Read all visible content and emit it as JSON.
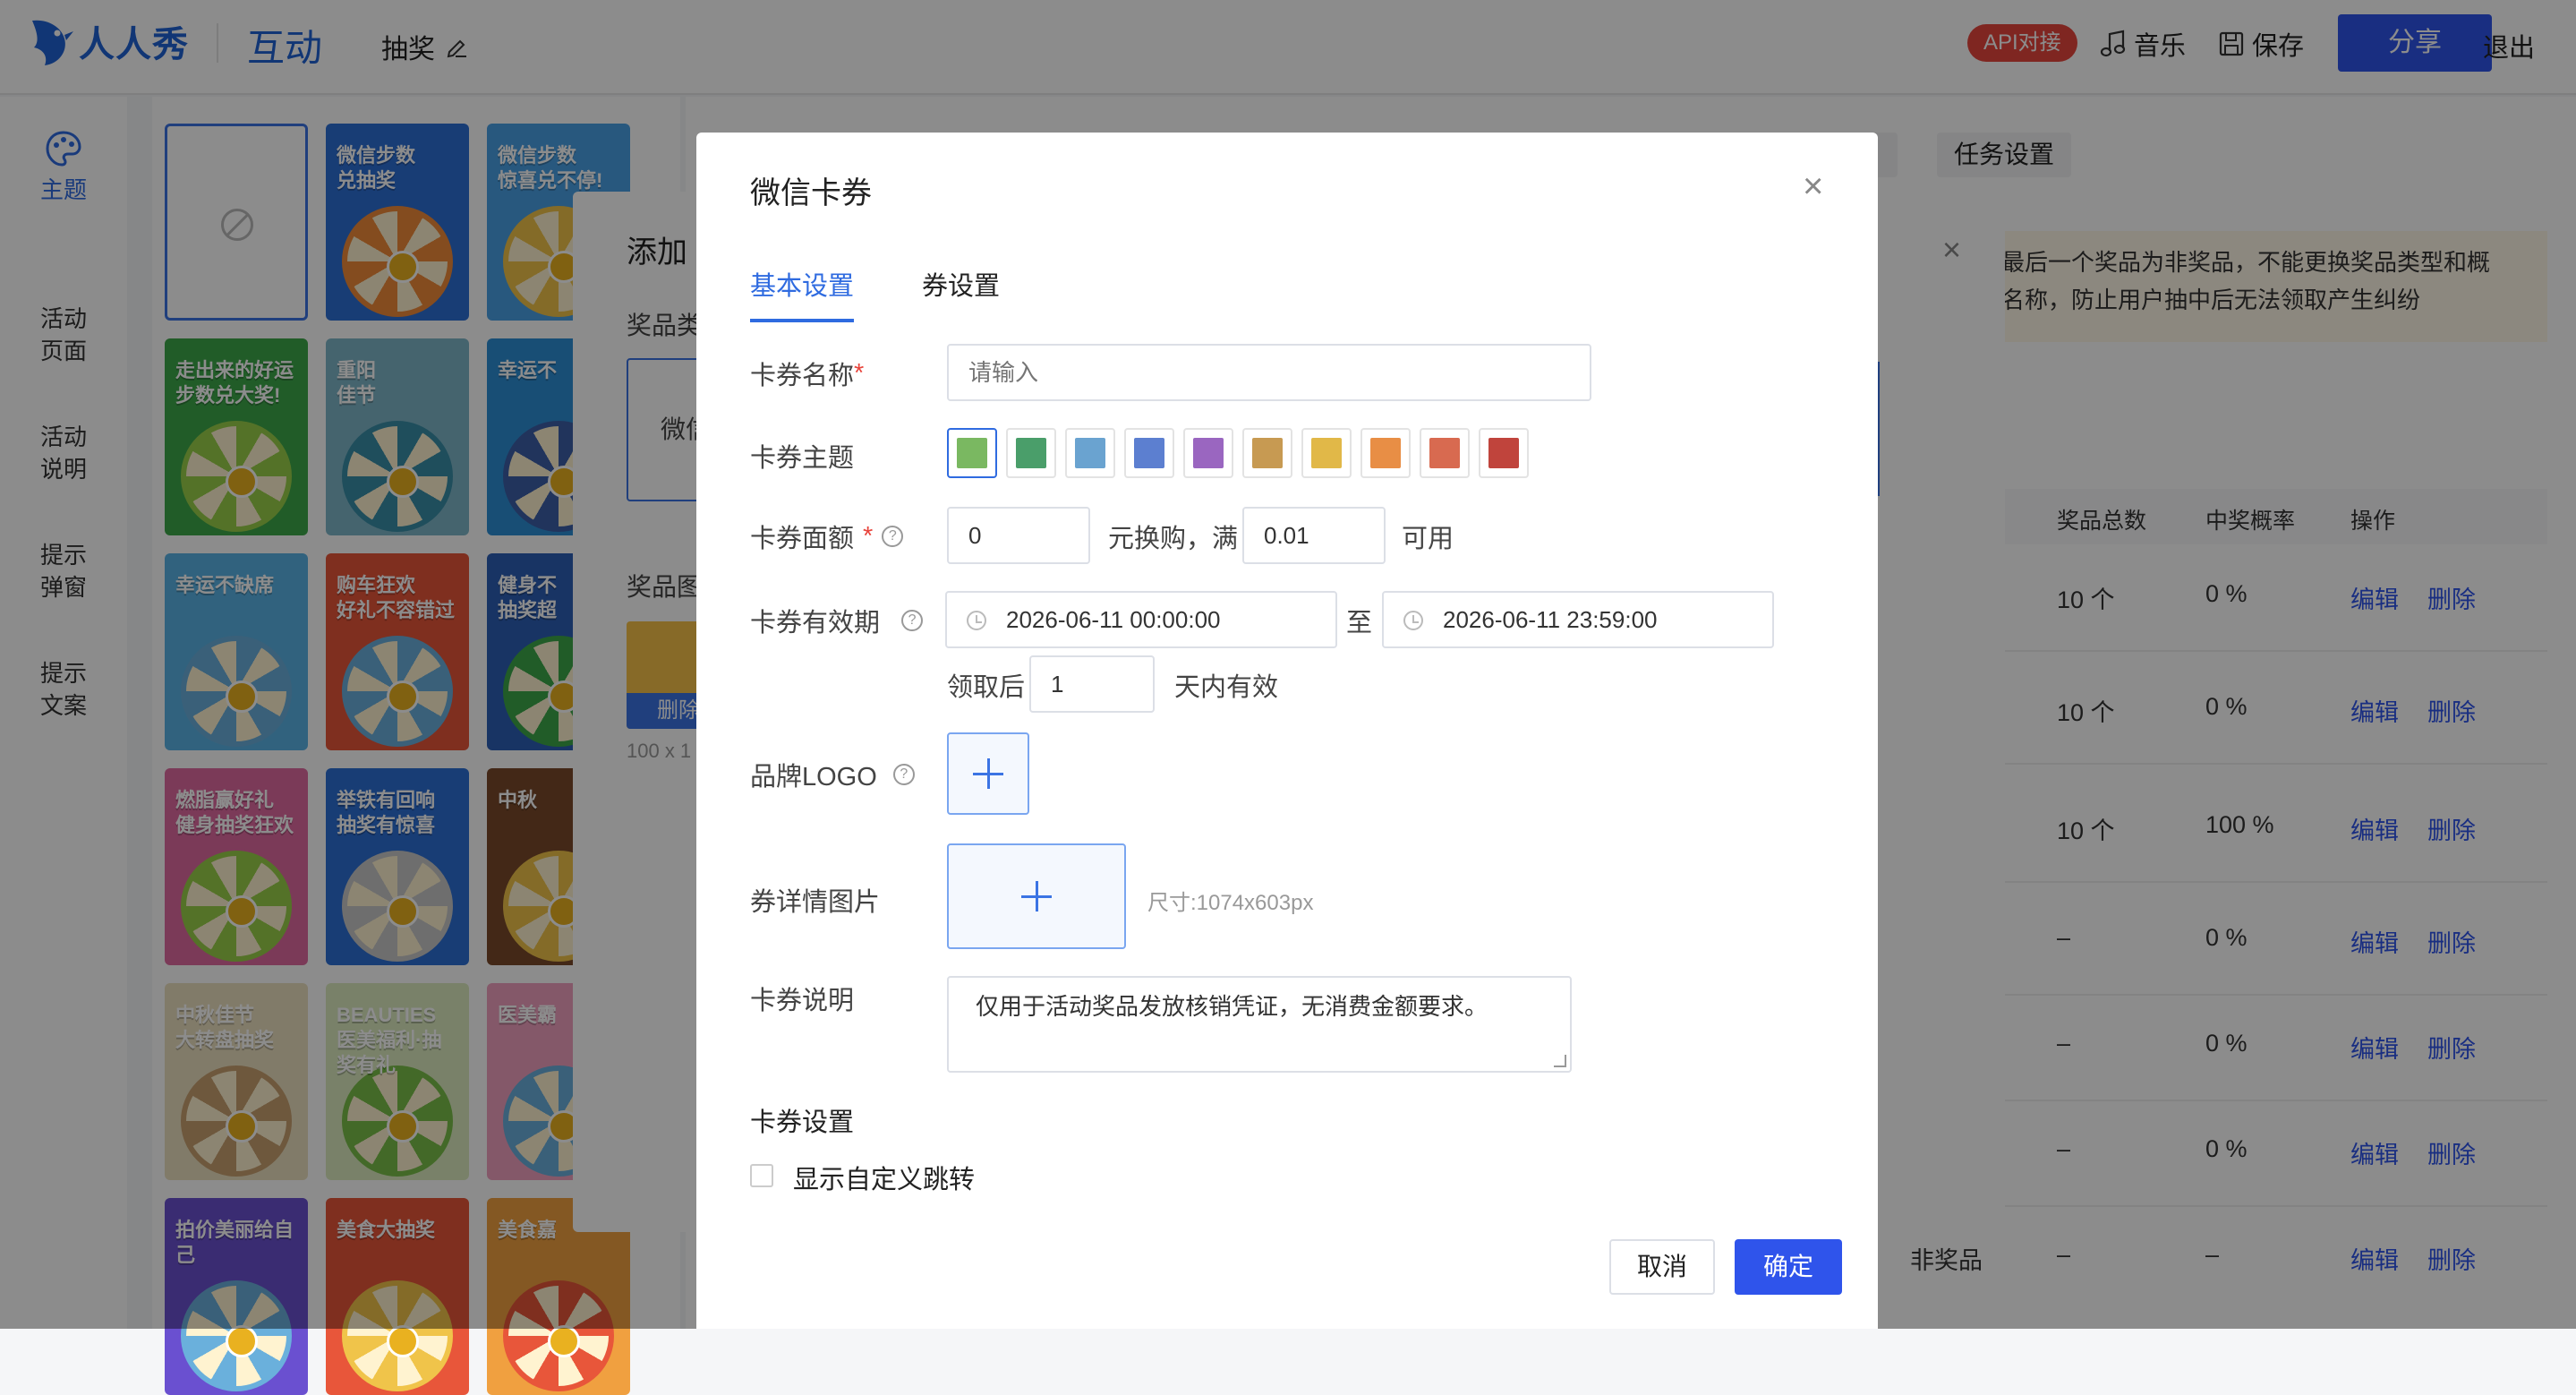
{
  "header": {
    "brand": "人人秀",
    "section": "互动",
    "page_name": "抽奖",
    "api_badge": "API对接",
    "music": "音乐",
    "save": "保存",
    "share": "分享",
    "exit": "退出"
  },
  "sidebar": {
    "items": [
      {
        "label": "主题"
      },
      {
        "label": "活动\n页面"
      },
      {
        "label": "活动\n说明"
      },
      {
        "label": "提示\n弹窗"
      },
      {
        "label": "提示\n文案"
      }
    ]
  },
  "templates": [
    {
      "title": ""
    },
    {
      "title": "微信步数\n兑抽奖",
      "bg": "#2c6fd6",
      "wheel": "#f08a3a"
    },
    {
      "title": "微信步数\n惊喜兑不停!",
      "bg": "#4aa0e6",
      "wheel": "#f0c44a"
    },
    {
      "title": "走出来的好运\n步数兑大奖!",
      "bg": "#3da84a",
      "wheel": "#9ad04a"
    },
    {
      "title": "重阳\n佳节",
      "bg": "#7fb6c8",
      "wheel": "#3a8fa8"
    },
    {
      "title": "幸运不",
      "bg": "#2c8ed6",
      "wheel": "#3d5fa8"
    },
    {
      "title": "幸运不缺席",
      "bg": "#5ab3e6",
      "wheel": "#6ab0dc"
    },
    {
      "title": "购车狂欢\n好礼不容错过",
      "bg": "#e8563a",
      "wheel": "#6ab0dc"
    },
    {
      "title": "健身不\n抽奖超",
      "bg": "#2c5fb6",
      "wheel": "#3da84a"
    },
    {
      "title": "燃脂赢好礼\n健身抽奖狂欢",
      "bg": "#e06aa0",
      "wheel": "#9ad04a"
    },
    {
      "title": "举铁有回响\n抽奖有惊喜",
      "bg": "#2c6fd6",
      "wheel": "#c8c8c8"
    },
    {
      "title": "中秋",
      "bg": "#7a4a2a",
      "wheel": "#f0c44a"
    },
    {
      "title": "中秋佳节\n大转盘抽奖",
      "bg": "#ece0c0",
      "wheel": "#c8a070"
    },
    {
      "title": "BEAUTIES\n医美福利·抽奖有礼",
      "bg": "#dcecc0",
      "wheel": "#7ac04a"
    },
    {
      "title": "医美霸",
      "bg": "#f0a0c0",
      "wheel": "#6ab0dc"
    },
    {
      "title": "拍价美丽给自己",
      "bg": "#6a50d0",
      "wheel": "#6ab0dc"
    },
    {
      "title": "美食大抽奖",
      "bg": "#e8563a",
      "wheel": "#f0c44a"
    },
    {
      "title": "美食嘉",
      "bg": "#f0a040",
      "wheel": "#e8563a"
    }
  ],
  "background_panel": {
    "task_tab": "任务设置",
    "warning": "最后一个奖品为非奖品，不能更换奖品类型和概\n名称，防止用户抽中后无法领取产生纠纷",
    "columns": [
      "奖品总数",
      "中奖概率",
      "操作"
    ],
    "rows": [
      {
        "name": "",
        "total": "10 个",
        "prob": "0 %"
      },
      {
        "name": "",
        "total": "10 个",
        "prob": "0 %"
      },
      {
        "name": "",
        "total": "10 个",
        "prob": "100 %"
      },
      {
        "name": "",
        "total": "–",
        "prob": "0 %"
      },
      {
        "name": "",
        "total": "–",
        "prob": "0 %"
      },
      {
        "name": "",
        "total": "–",
        "prob": "0 %"
      },
      {
        "name": "非奖品",
        "total": "–",
        "prob": "–"
      }
    ],
    "edit": "编辑",
    "delete": "删除",
    "confirm": "确定"
  },
  "prize_modal": {
    "title": "添加",
    "type_label": "奖品类",
    "type_box": "微信",
    "image_label": "奖品图",
    "delete": "删除",
    "size": "100 x 1"
  },
  "dialog": {
    "title": "微信卡券",
    "tabs": [
      "基本设置",
      "券设置"
    ],
    "name_label": "卡券名称",
    "name_placeholder": "请输入",
    "theme_label": "卡券主题",
    "theme_colors": [
      "#7ab861",
      "#4a9e6a",
      "#6aa3d0",
      "#5c7fd0",
      "#9a66c0",
      "#c79a52",
      "#e1b848",
      "#e88e45",
      "#d86a50",
      "#c0443c"
    ],
    "amount_label": "卡券面额",
    "amount_value": "0",
    "amount_mid": "元换购，满",
    "min_value": "0.01",
    "amount_tail": "可用",
    "validity_label": "卡券有效期",
    "start_time": "2026-06-11 00:00:00",
    "to": "至",
    "end_time": "2026-06-11 23:59:00",
    "after_label": "领取后",
    "after_value": "1",
    "after_tail": "天内有效",
    "logo_label": "品牌LOGO",
    "detail_label": "券详情图片",
    "detail_size": "尺寸:1074x603px",
    "desc_label": "卡券说明",
    "desc_value": "仅用于活动奖品发放核销凭证，无消费金额要求。",
    "section_label": "卡券设置",
    "custom_jump": "显示自定义跳转",
    "cancel": "取消",
    "ok": "确定"
  }
}
